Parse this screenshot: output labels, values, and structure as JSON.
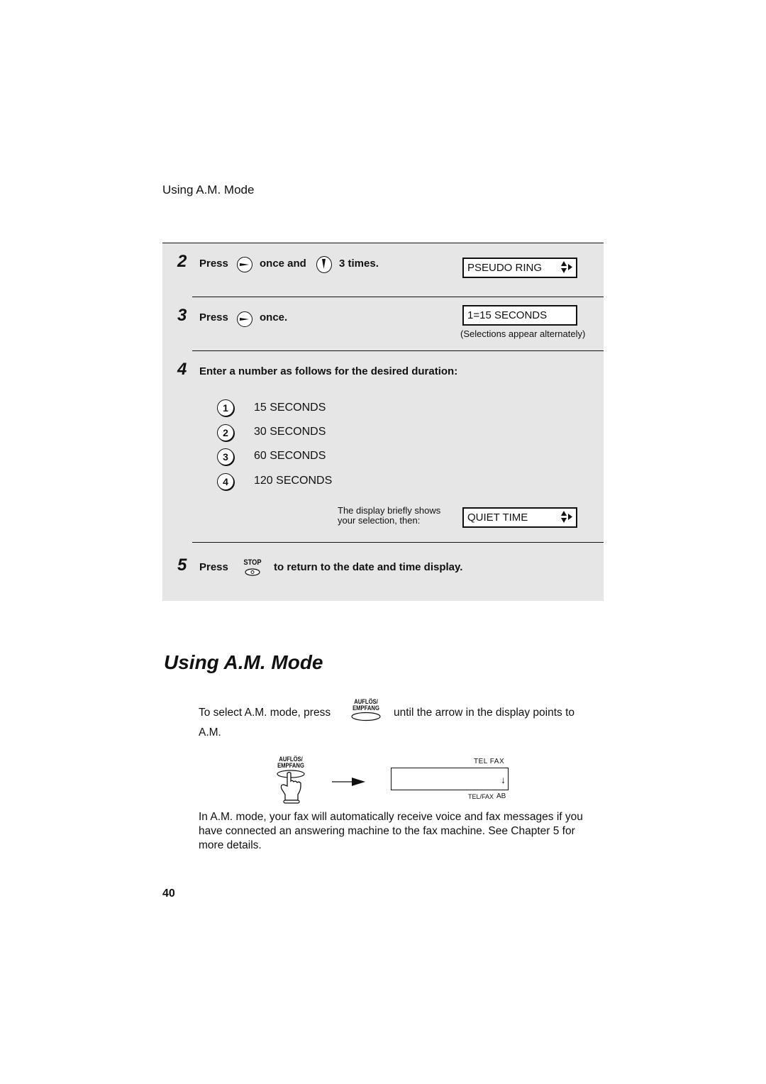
{
  "running_head": "Using A.M. Mode",
  "steps": [
    {
      "number": "2",
      "parts": [
        "Press",
        "once and",
        "3 times."
      ],
      "icons": [
        "right-arrow-button",
        "down-arrow-button"
      ],
      "display": "PSEUDO RING",
      "display_icon": "up-down-right-arrows"
    },
    {
      "number": "3",
      "parts": [
        "Press",
        "once."
      ],
      "icons": [
        "right-arrow-button"
      ],
      "display": "1=15 SECONDS",
      "display_note": "(Selections appear alternately)"
    },
    {
      "number": "4",
      "text": "Enter a number as follows for the desired duration:",
      "options": [
        {
          "key": "1",
          "label": "15 SECONDS"
        },
        {
          "key": "2",
          "label": "30 SECONDS"
        },
        {
          "key": "3",
          "label": "60 SECONDS"
        },
        {
          "key": "4",
          "label": "120 SECONDS"
        }
      ],
      "note_line1": "The display briefly shows",
      "note_line2": "your selection, then:",
      "display": "QUIET TIME",
      "display_icon": "up-down-right-arrows"
    },
    {
      "number": "5",
      "press": "Press",
      "key_label": "STOP",
      "text": "to return to the date and time display."
    }
  ],
  "section": {
    "title": "Using A.M. Mode",
    "intro_before": "To select A.M. mode, press",
    "key_line1": "AUFLÖS/",
    "key_line2": "EMPFANG",
    "intro_after": "until the arrow in the display points to",
    "intro_end": "A.M.",
    "diagram": {
      "key_line1": "AUFLÖS/",
      "key_line2": "EMPFANG",
      "top_labels": "TEL  FAX",
      "bottom_label_1": "TEL/FAX",
      "bottom_label_2": "AB",
      "arrow_glyph": "↓"
    },
    "paragraph": "In A.M. mode, your fax will automatically receive voice and fax messages if you have connected an answering machine to the fax machine. See Chapter 5 for more details."
  },
  "page_number": "40"
}
